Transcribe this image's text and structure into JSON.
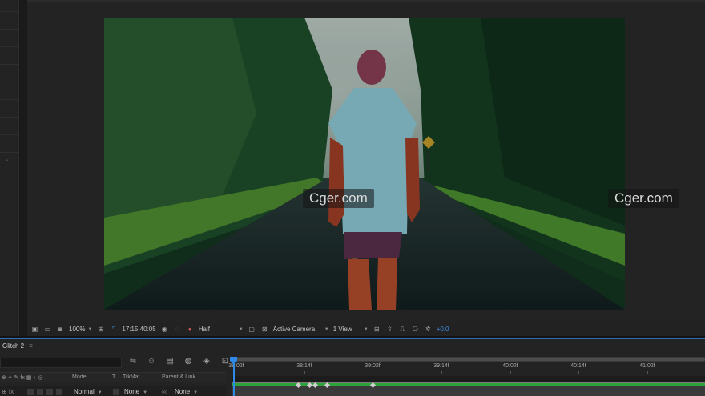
{
  "viewer": {
    "watermarks": [
      "Cger.com",
      "Cger.com"
    ]
  },
  "viewer_toolbar": {
    "zoom": "100%",
    "timecode": "17:15:40:05",
    "resolution": "Half",
    "camera": "Active Camera",
    "view": "1 View",
    "exposure": "+0.0"
  },
  "timeline": {
    "tab_label": "Glitch 2",
    "menu_glyph": "≡",
    "columns": {
      "mode": "Mode",
      "t": "T",
      "trkmat": "TrkMat",
      "parent": "Parent & Link"
    },
    "layer": {
      "mode": "Normal",
      "trkmat": "None",
      "parent": "None"
    },
    "ruler_ticks": [
      "38:02f",
      "38:14f",
      "39:02f",
      "39:14f",
      "40:02f",
      "40:14f",
      "41:02f"
    ],
    "colors": {
      "playhead": "#2e8ae6",
      "layer_bar": "#2da33a",
      "marker": "#d03030"
    }
  }
}
